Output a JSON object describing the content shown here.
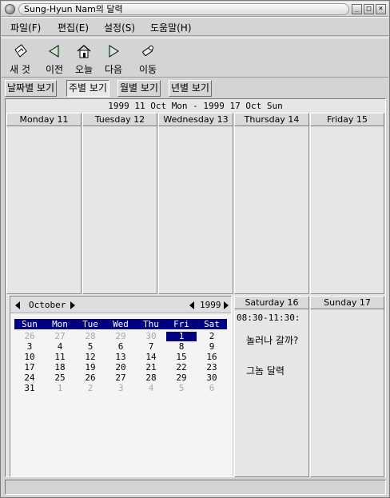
{
  "window": {
    "title": "Sung-Hyun Nam의 달력",
    "buttons": [
      "_",
      "□",
      "×"
    ]
  },
  "menu": [
    {
      "label": "파일(F)"
    },
    {
      "label": "편집(E)"
    },
    {
      "label": "설정(S)"
    },
    {
      "label": "도움말(H)"
    }
  ],
  "toolbar": [
    {
      "label": "새 것",
      "icon": "new-document-icon"
    },
    {
      "label": "이전",
      "icon": "arrow-left-icon"
    },
    {
      "label": "오늘",
      "icon": "home-icon"
    },
    {
      "label": "다음",
      "icon": "arrow-right-icon"
    },
    {
      "label": "이동",
      "icon": "goto-pointer-icon"
    }
  ],
  "view_tabs": [
    {
      "label": "날짜별 보기",
      "active": false
    },
    {
      "label": "주별 보기",
      "active": true
    },
    {
      "label": "월별 보기",
      "active": false
    },
    {
      "label": "년별 보기",
      "active": false
    }
  ],
  "week": {
    "range": "1999 11 Oct Mon - 1999 17 Oct Sun",
    "days": [
      {
        "label": "Monday 11"
      },
      {
        "label": "Tuesday 12"
      },
      {
        "label": "Wednesday 13"
      },
      {
        "label": "Thursday 14"
      },
      {
        "label": "Friday 15"
      },
      {
        "label": "Saturday 16"
      },
      {
        "label": "Sunday 17"
      }
    ],
    "saturday_event": {
      "time": "08:30-11:30:",
      "title": "놀러나 갈까?",
      "note": "그놈 달력"
    }
  },
  "mini_month": {
    "month": "October",
    "year": "1999",
    "weekdays": [
      "Sun",
      "Mon",
      "Tue",
      "Wed",
      "Thu",
      "Fri",
      "Sat"
    ],
    "selected_day": "1",
    "weeks": [
      [
        "26",
        "27",
        "28",
        "29",
        "30",
        "1",
        "2"
      ],
      [
        "3",
        "4",
        "5",
        "6",
        "7",
        "8",
        "9"
      ],
      [
        "10",
        "11",
        "12",
        "13",
        "14",
        "15",
        "16"
      ],
      [
        "17",
        "18",
        "19",
        "20",
        "21",
        "22",
        "23"
      ],
      [
        "24",
        "25",
        "26",
        "27",
        "28",
        "29",
        "30"
      ],
      [
        "31",
        "1",
        "2",
        "3",
        "4",
        "5",
        "6"
      ]
    ],
    "other_month_cells": [
      [
        0,
        0
      ],
      [
        0,
        1
      ],
      [
        0,
        2
      ],
      [
        0,
        3
      ],
      [
        0,
        4
      ],
      [
        5,
        1
      ],
      [
        5,
        2
      ],
      [
        5,
        3
      ],
      [
        5,
        4
      ],
      [
        5,
        5
      ],
      [
        5,
        6
      ]
    ]
  },
  "colors": {
    "selection": "#000080",
    "background": "#d4d4d4",
    "panel": "#e6e6e6"
  },
  "status": {
    "text": ""
  }
}
